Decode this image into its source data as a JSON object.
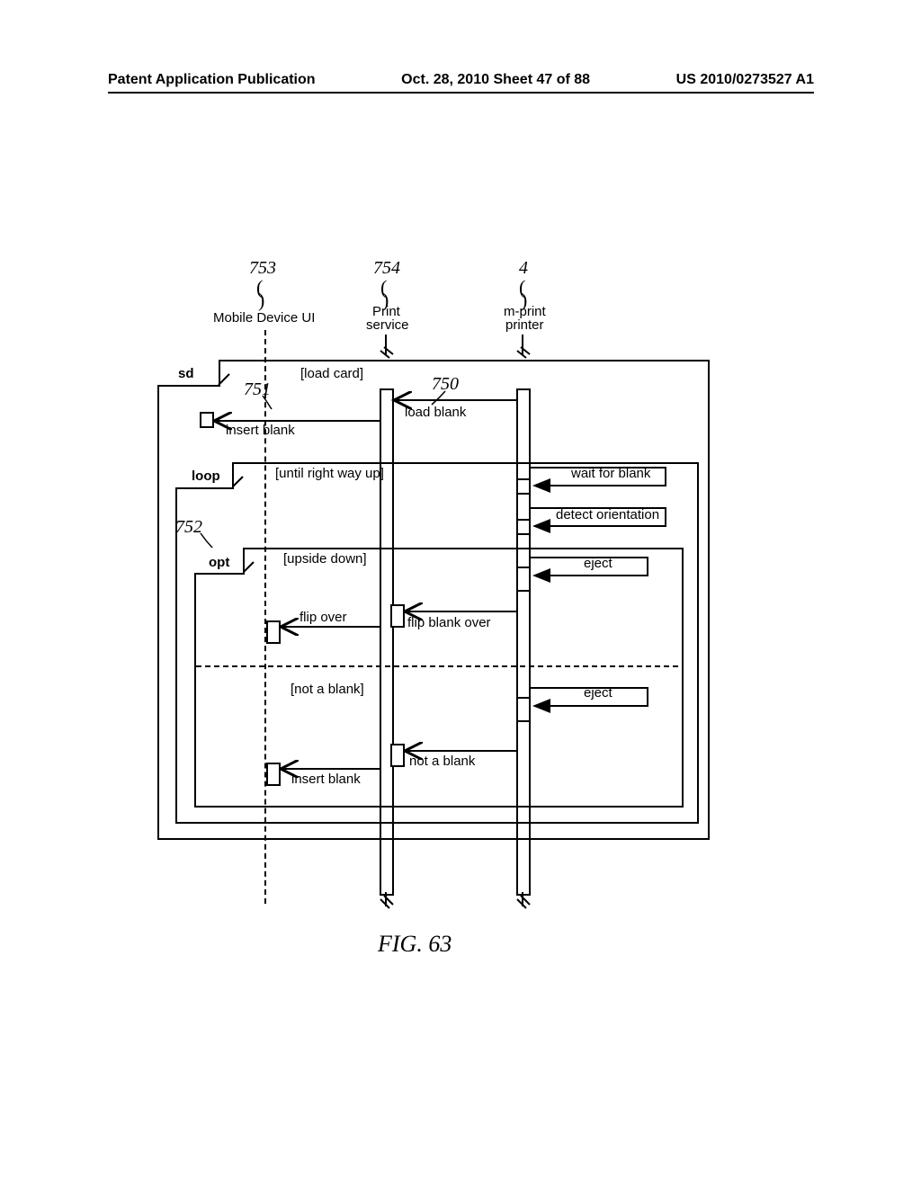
{
  "header": {
    "left": "Patent Application Publication",
    "middle": "Oct. 28, 2010   Sheet 47 of 88",
    "right": "US 2010/0273527 A1"
  },
  "refs": {
    "r753": "753",
    "r754": "754",
    "r4": "4",
    "r751": "751",
    "r750": "750",
    "r752": "752"
  },
  "lifelines": {
    "mobile": "Mobile Device UI",
    "print_service_top": "Print",
    "print_service_bottom": "service",
    "mprint_top": "m-print",
    "mprint_bottom": "printer"
  },
  "fragments": {
    "sd": "sd",
    "loop": "loop",
    "opt": "opt"
  },
  "guards": {
    "load_card": "[load card]",
    "until_right": "[until right way up]",
    "upside_down": "[upside down]",
    "not_blank": "[not a blank]"
  },
  "messages": {
    "load_blank": "load blank",
    "insert_blank": "insert blank",
    "wait_for_blank": "wait for blank",
    "detect_orientation": "detect orientation",
    "eject": "eject",
    "flip_over": "flip over",
    "flip_blank_over": "flip blank over",
    "not_a_blank": "not a blank",
    "insert_blank2": "insert blank"
  },
  "figure": "FIG. 63",
  "chart_data": {
    "type": "uml-sequence-diagram",
    "title": "FIG. 63",
    "lifelines": [
      {
        "name": "Mobile Device UI",
        "ref": "753"
      },
      {
        "name": "Print service",
        "ref": "754"
      },
      {
        "name": "m-print printer",
        "ref": "4"
      }
    ],
    "fragments": [
      {
        "type": "sd",
        "guard": "[load card]",
        "messages": [
          {
            "from": "m-print printer",
            "to": "Print service",
            "label": "load blank",
            "ref": "750"
          },
          {
            "from": "Print service",
            "to": "Mobile Device UI",
            "label": "insert blank",
            "ref": "751"
          }
        ],
        "children": [
          {
            "type": "loop",
            "guard": "[until right way up]",
            "ref": "752",
            "messages": [
              {
                "from": "m-print printer",
                "to": "m-print printer",
                "label": "wait for blank",
                "self": true
              },
              {
                "from": "m-print printer",
                "to": "m-print printer",
                "label": "detect orientation",
                "self": true
              }
            ],
            "children": [
              {
                "type": "opt",
                "operands": [
                  {
                    "guard": "[upside down]",
                    "messages": [
                      {
                        "from": "m-print printer",
                        "to": "m-print printer",
                        "label": "eject",
                        "self": true
                      },
                      {
                        "from": "m-print printer",
                        "to": "Print service",
                        "label": "flip blank over"
                      },
                      {
                        "from": "Print service",
                        "to": "Mobile Device UI",
                        "label": "flip over"
                      }
                    ]
                  },
                  {
                    "guard": "[not a blank]",
                    "messages": [
                      {
                        "from": "m-print printer",
                        "to": "m-print printer",
                        "label": "eject",
                        "self": true
                      },
                      {
                        "from": "m-print printer",
                        "to": "Print service",
                        "label": "not a blank"
                      },
                      {
                        "from": "Print service",
                        "to": "Mobile Device UI",
                        "label": "insert blank"
                      }
                    ]
                  }
                ]
              }
            ]
          }
        ]
      }
    ]
  }
}
